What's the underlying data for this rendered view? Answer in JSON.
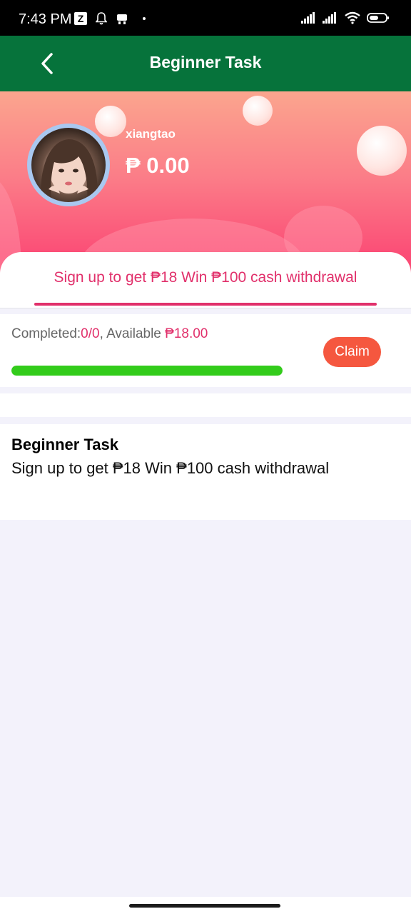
{
  "status_bar": {
    "time": "7:43 PM",
    "z_badge": "Z",
    "icons": [
      "z-icon",
      "bell-icon",
      "robot-icon",
      "signal-icon",
      "signal-icon",
      "wifi-icon",
      "battery-icon"
    ]
  },
  "header": {
    "title": "Beginner Task",
    "back_icon": "chevron-left-icon"
  },
  "profile": {
    "username": "xiangtao",
    "balance": "₱ 0.00"
  },
  "tab": {
    "label": "Sign up to get ₱18  Win ₱100 cash withdrawal"
  },
  "progress": {
    "completed_label": "Completed:",
    "completed_value": "0/0",
    "available_label": ", Available ",
    "available_value": "₱18.00",
    "claim_label": "Claim",
    "fill_fraction": 1.0
  },
  "task": {
    "title": "Beginner Task",
    "description": "Sign up to get ₱18 Win ₱100 cash withdrawal"
  },
  "colors": {
    "header_green": "#06733b",
    "accent_pink": "#e1306b",
    "progress_green": "#33cc1b",
    "claim_red": "#f5573f"
  }
}
